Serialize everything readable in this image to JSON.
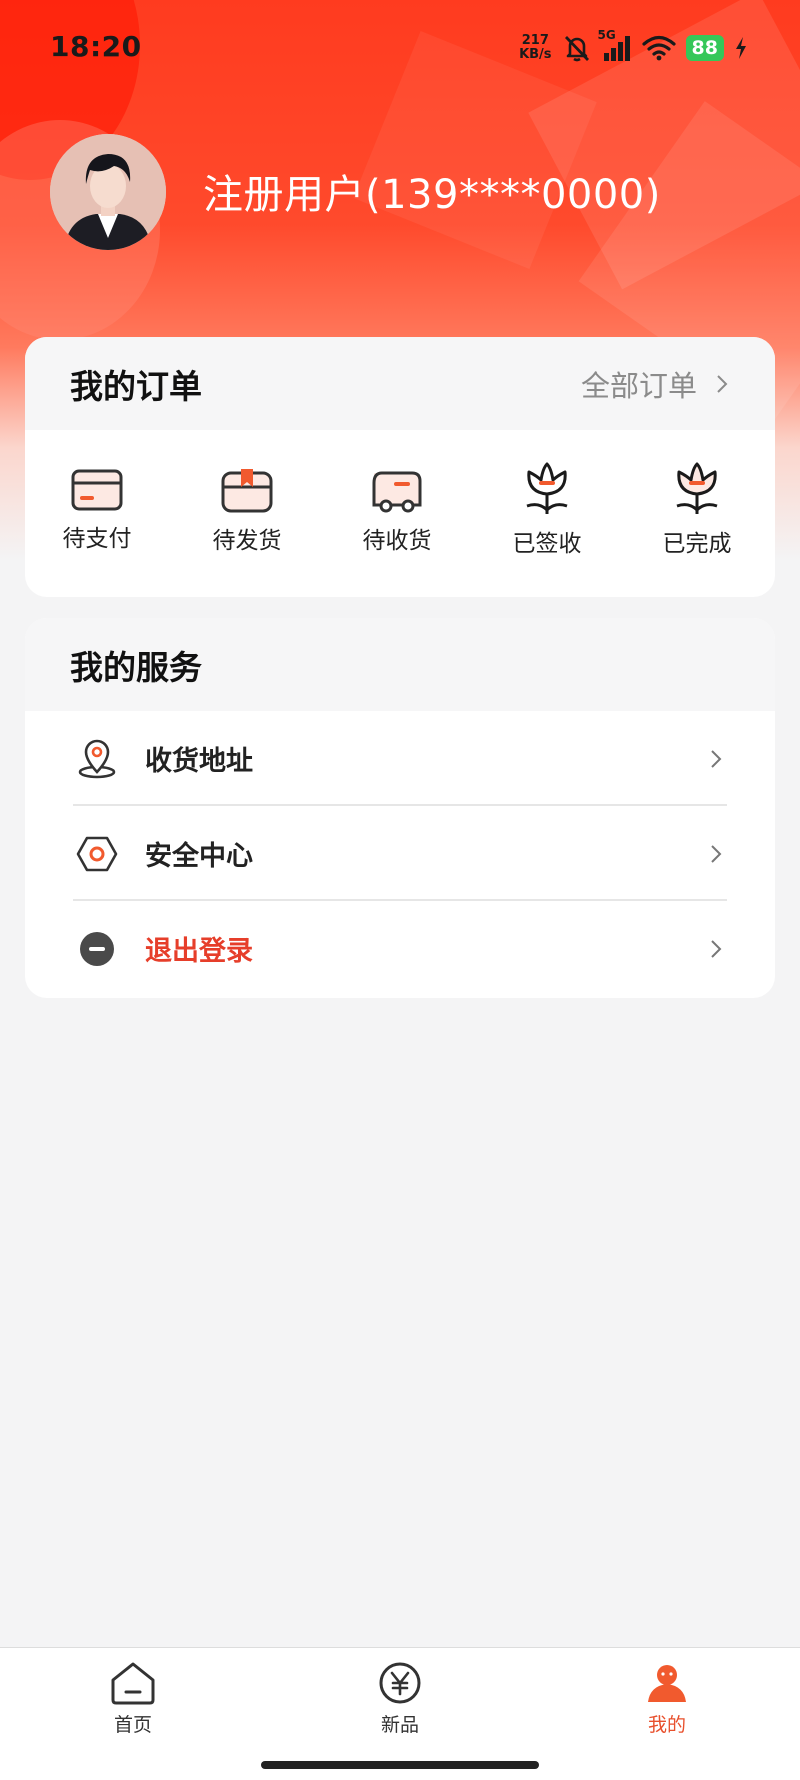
{
  "status_bar": {
    "time": "18:20",
    "net_speed_value": "217",
    "net_speed_unit": "KB/s",
    "network_type": "5G",
    "battery": "88",
    "icons": [
      "bell-muted-icon",
      "signal-icon",
      "wifi-icon",
      "battery-icon",
      "charging-icon"
    ]
  },
  "profile": {
    "name": "注册用户(139****0000)",
    "avatar_icon": "avatar-icon"
  },
  "orders": {
    "title": "我的订单",
    "all_label": "全部订单",
    "items": [
      {
        "label": "待支付",
        "icon": "card-icon"
      },
      {
        "label": "待发货",
        "icon": "box-icon"
      },
      {
        "label": "待收货",
        "icon": "truck-icon"
      },
      {
        "label": "已签收",
        "icon": "flower-icon"
      },
      {
        "label": "已完成",
        "icon": "flower-icon"
      }
    ]
  },
  "services": {
    "title": "我的服务",
    "items": [
      {
        "label": "收货地址",
        "icon": "location-pin-icon"
      },
      {
        "label": "安全中心",
        "icon": "hexagon-nut-icon"
      },
      {
        "label": "退出登录",
        "icon": "minus-circle-icon"
      }
    ]
  },
  "tab_bar": {
    "items": [
      {
        "label": "首页",
        "icon": "home-icon"
      },
      {
        "label": "新品",
        "icon": "yen-icon"
      },
      {
        "label": "我的",
        "icon": "user-icon"
      }
    ],
    "active_index": 2
  },
  "colors": {
    "brand": "#ff3b1f",
    "accent": "#e8502d",
    "danger": "#e63e2a",
    "page_bg": "#f4f4f5"
  }
}
